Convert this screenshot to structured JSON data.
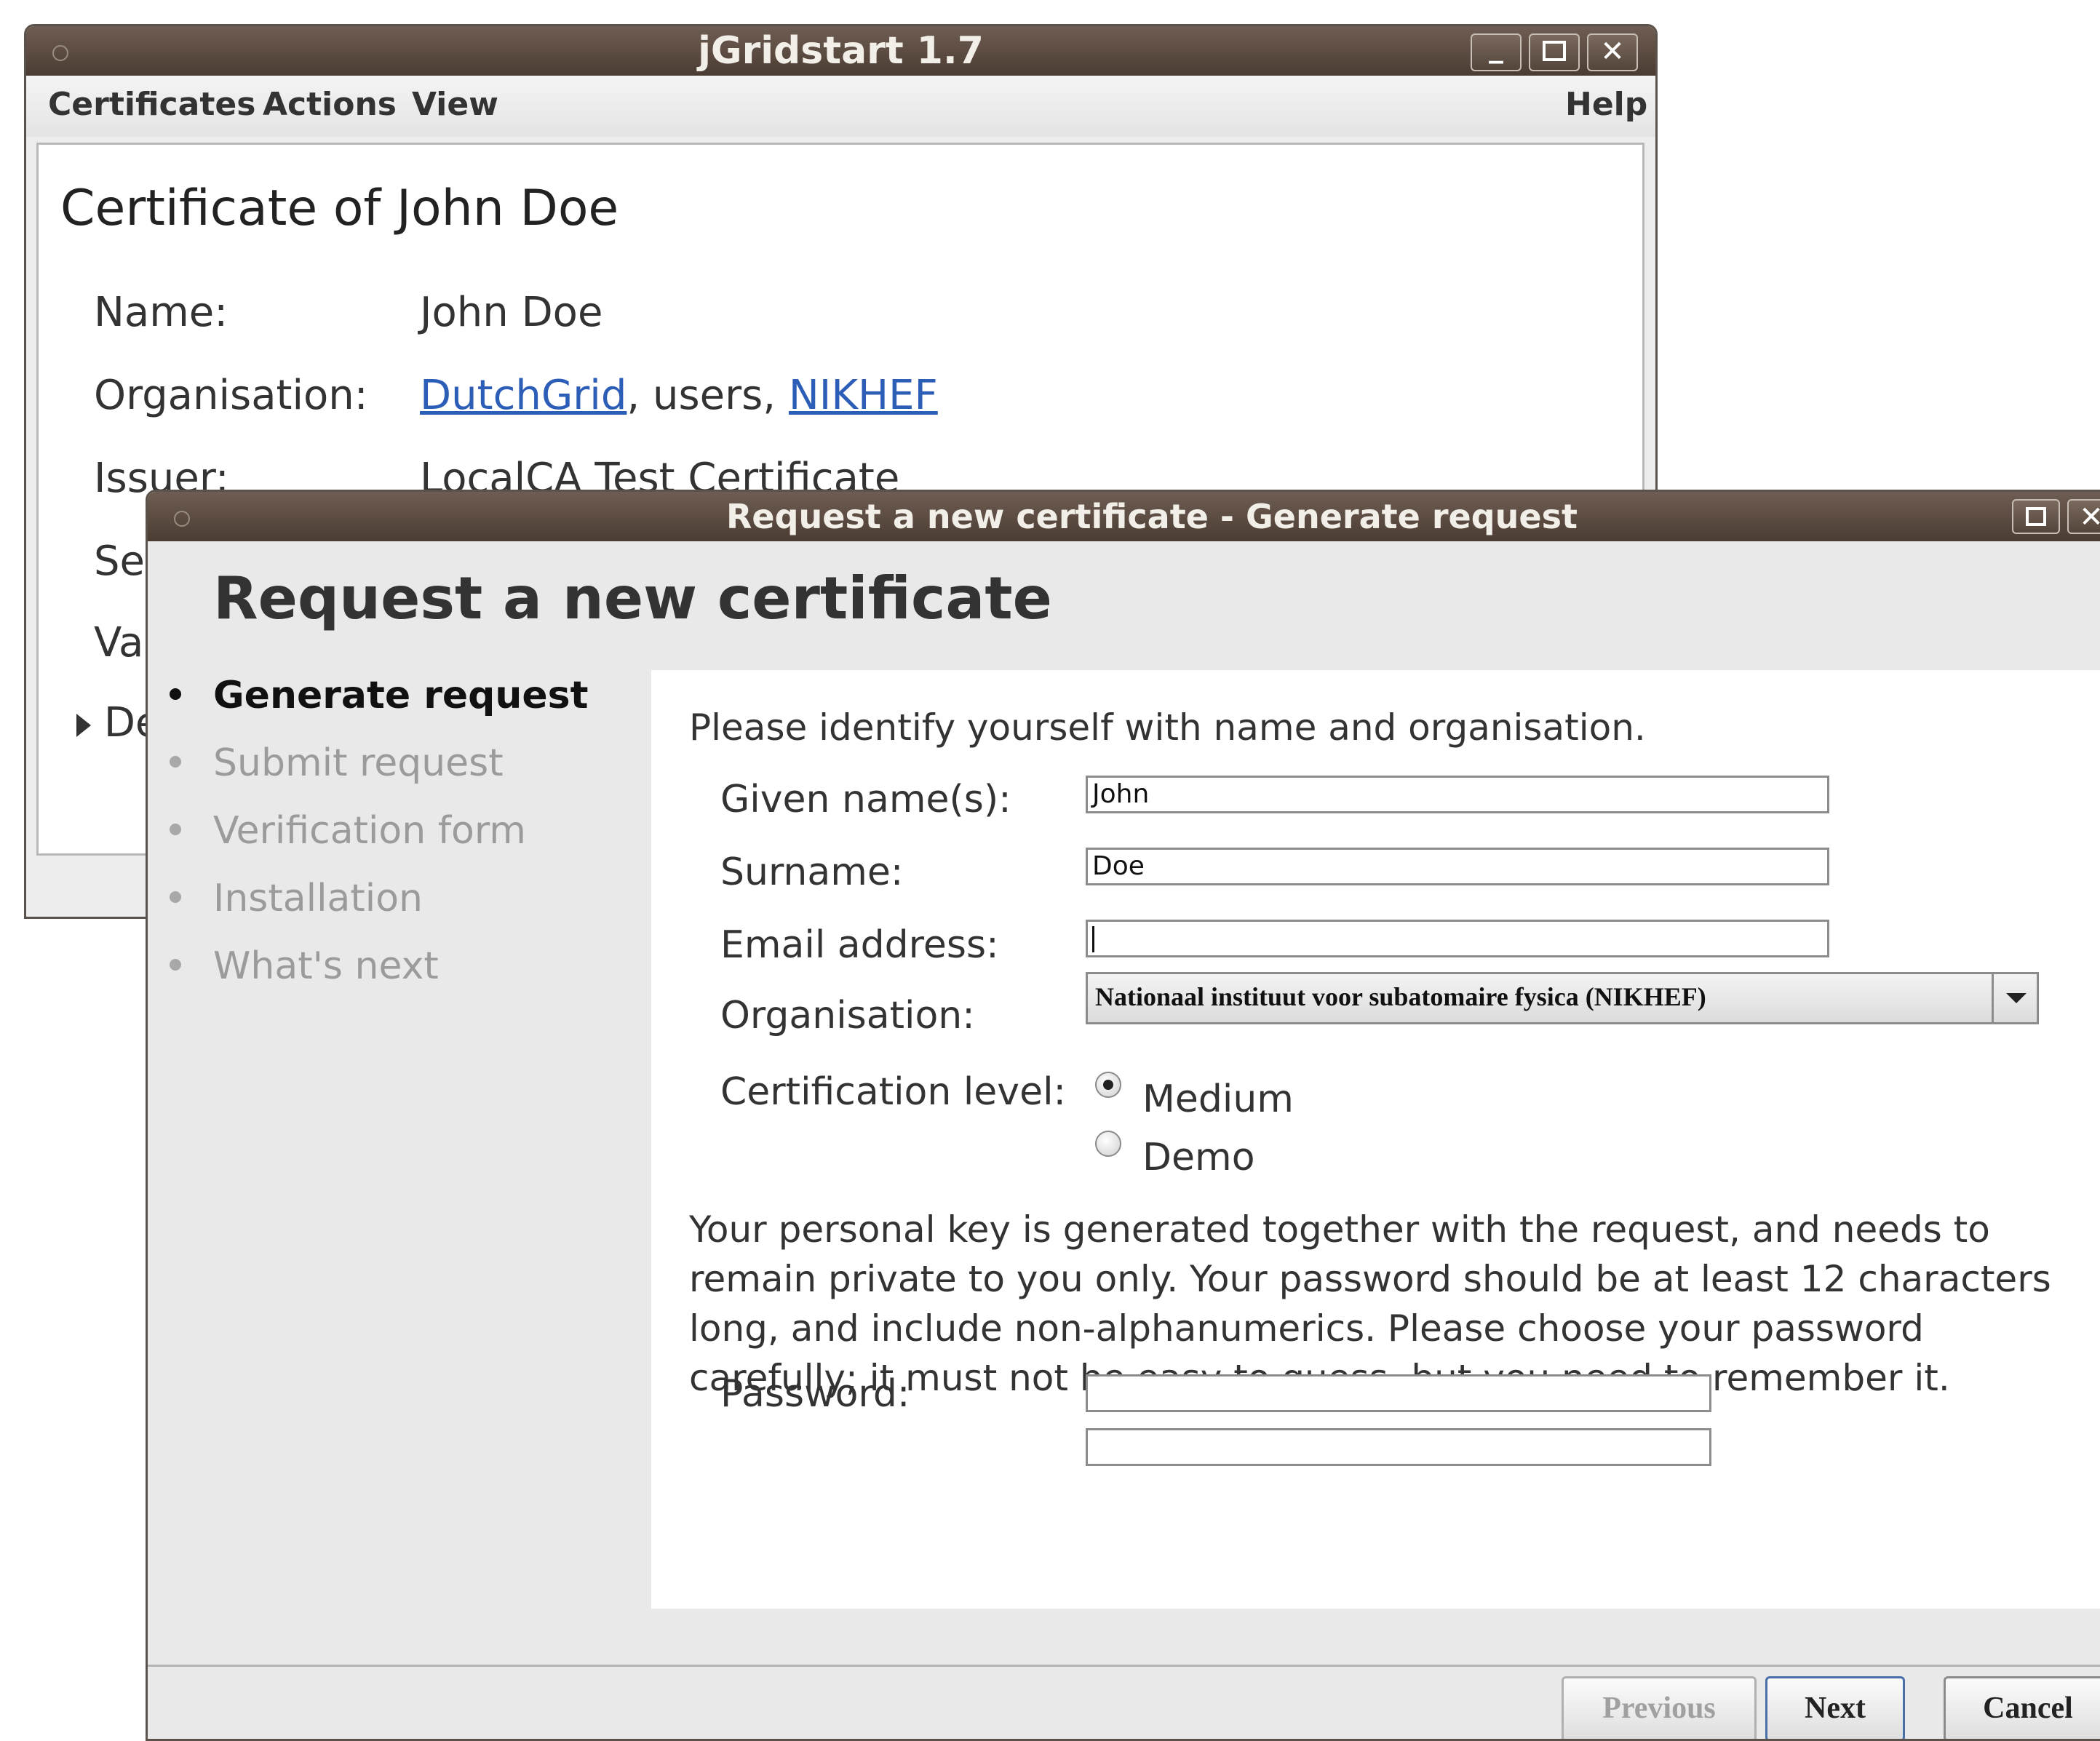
{
  "main_window": {
    "title": "jGridstart 1.7",
    "controls": {
      "minimize": "_",
      "maximize": "□",
      "close": "✕"
    },
    "menu": {
      "certificates": "Certificates",
      "actions": "Actions",
      "view": "View",
      "help": "Help"
    },
    "heading": "Certificate of John Doe",
    "fields": {
      "name_label": "Name:",
      "name_value": "John Doe",
      "org_label": "Organisation:",
      "org_link1": "DutchGrid",
      "org_sep": ", users, ",
      "org_link2": "NIKHEF",
      "issuer_label": "Issuer:",
      "issuer_value": "LocalCA Test Certificate",
      "partial_se": "Se",
      "partial_va": "Va",
      "partial_de": "De"
    }
  },
  "dialog": {
    "title": "Request a new certificate - Generate request",
    "heading": "Request a new certificate",
    "steps": [
      {
        "label": "Generate request",
        "state": "active"
      },
      {
        "label": "Submit request",
        "state": "inactive"
      },
      {
        "label": "Verification form",
        "state": "inactive"
      },
      {
        "label": "Installation",
        "state": "inactive"
      },
      {
        "label": "What's next",
        "state": "inactive"
      }
    ],
    "intro": "Please identify yourself with name and organisation.",
    "form": {
      "given_name_label": "Given name(s):",
      "given_name_value": "John",
      "surname_label": "Surname:",
      "surname_value": "Doe",
      "email_label": "Email address:",
      "email_value": "",
      "organisation_label": "Organisation:",
      "organisation_value": "Nationaal instituut voor subatomaire fysica (NIKHEF)",
      "cert_level_label": "Certification level:",
      "level_medium": "Medium",
      "level_demo": "Demo",
      "selected_level": "Medium",
      "password_label": "Password:"
    },
    "key_paragraph": "Your personal key is generated together with the request, and needs to remain private to you only. Your password should be at least 12 characters long, and include non-alphanumerics. Please choose your password carefully; it must not be easy to guess, but you need to remember it.",
    "buttons": {
      "previous": "Previous",
      "next": "Next",
      "cancel": "Cancel"
    }
  },
  "colors": {
    "titlebar": "#5b4a40",
    "link": "#2c5eb8",
    "panel": "#e9e9e9"
  }
}
